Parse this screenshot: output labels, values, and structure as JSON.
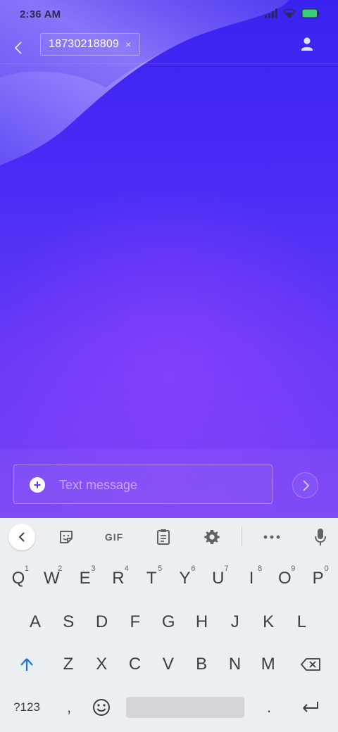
{
  "status_bar": {
    "time": "2:36 AM"
  },
  "app_bar": {
    "recipient": "18730218809",
    "chip_close": "×"
  },
  "compose": {
    "placeholder": "Text message",
    "add": "+"
  },
  "keyboard": {
    "toolbar": {
      "gif": "GIF"
    },
    "row1": [
      {
        "k": "Q",
        "h": "1"
      },
      {
        "k": "W",
        "h": "2"
      },
      {
        "k": "E",
        "h": "3"
      },
      {
        "k": "R",
        "h": "4"
      },
      {
        "k": "T",
        "h": "5"
      },
      {
        "k": "Y",
        "h": "6"
      },
      {
        "k": "U",
        "h": "7"
      },
      {
        "k": "I",
        "h": "8"
      },
      {
        "k": "O",
        "h": "9"
      },
      {
        "k": "P",
        "h": "0"
      }
    ],
    "row2": [
      "A",
      "S",
      "D",
      "F",
      "G",
      "H",
      "J",
      "K",
      "L"
    ],
    "row3": [
      "Z",
      "X",
      "C",
      "V",
      "B",
      "N",
      "M"
    ],
    "symbols": "?123",
    "comma": ",",
    "period": "."
  },
  "colors": {
    "accent": "#5a3ef5",
    "shift_active": "#1a73e8"
  },
  "icons": {
    "back": "chevron-left-icon",
    "contact": "person-icon",
    "send": "chevron-right-icon",
    "sticker": "sticker-icon",
    "clipboard": "clipboard-icon",
    "settings": "gear-icon",
    "more": "more-horizontal-icon",
    "mic": "mic-icon",
    "shift": "shift-arrow-icon",
    "backspace": "backspace-icon",
    "emoji": "emoji-icon",
    "enter": "enter-icon"
  }
}
